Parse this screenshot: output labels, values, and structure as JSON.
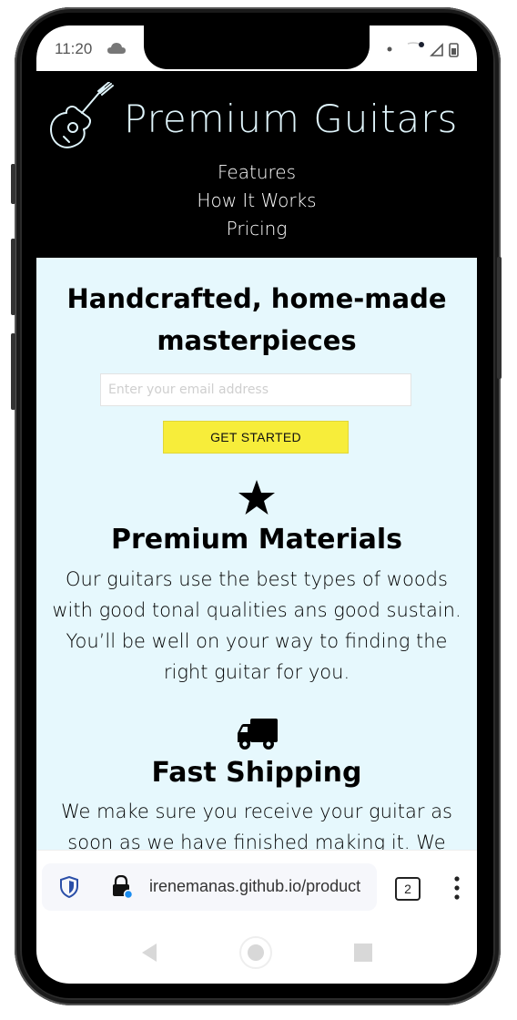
{
  "status_bar": {
    "time": "11:20"
  },
  "header": {
    "brand": "Premium Guitars",
    "nav": [
      "Features",
      "How It Works",
      "Pricing"
    ]
  },
  "hero": {
    "title_line1": "Handcrafted, home-made",
    "title_line2": "masterpieces",
    "email_placeholder": "Enter your email address",
    "cta_label": "GET STARTED"
  },
  "features": [
    {
      "icon": "star-icon",
      "title": "Premium Materials",
      "lines": [
        "Our guitars use the best types of woods",
        "with good tonal qualities ans good sustain.",
        "You’ll be well on your way to finding the",
        "right guitar for you."
      ]
    },
    {
      "icon": "truck-icon",
      "title": "Fast Shipping",
      "lines": [
        "We make sure you receive your guitar as",
        "soon as we have finished making it. We"
      ]
    }
  ],
  "browser": {
    "url": "irenemanas.github.io/product",
    "tab_count": "2"
  },
  "colors": {
    "header_bg": "#000000",
    "content_bg": "#e6f8fd",
    "cta_bg": "#f7ed3a",
    "brand_text": "#dff4fb"
  }
}
